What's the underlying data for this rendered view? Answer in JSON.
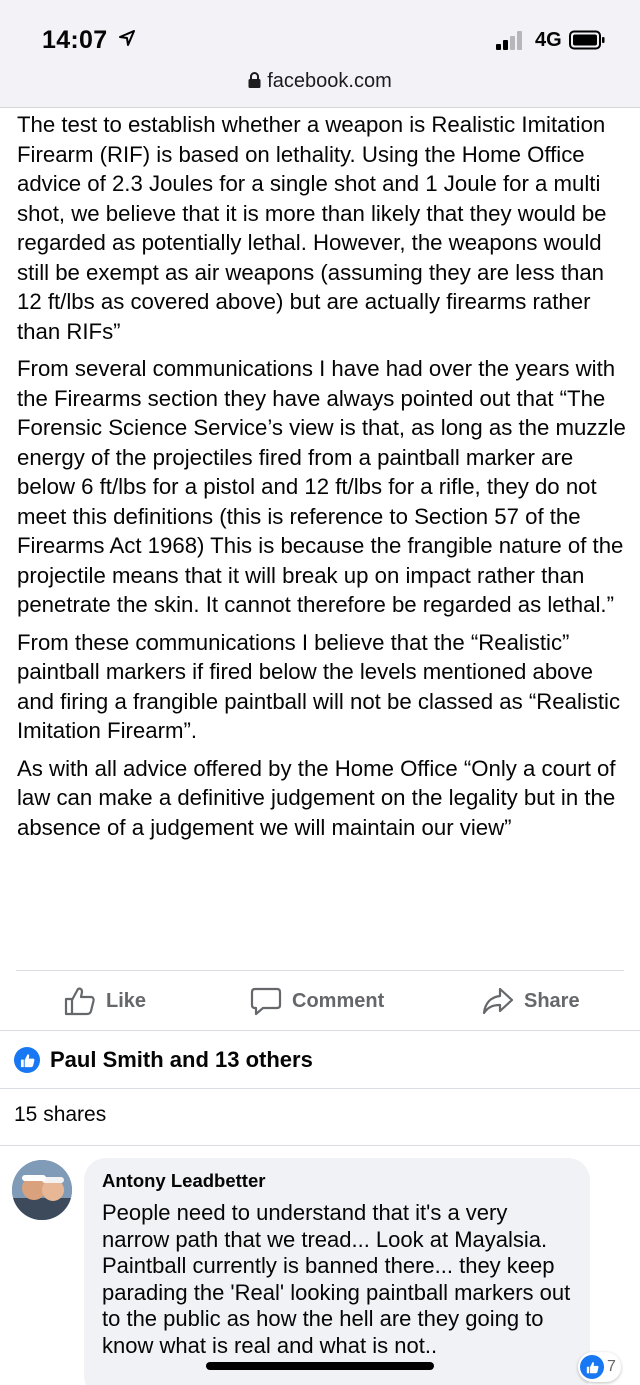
{
  "status_bar": {
    "time": "14:07",
    "network": "4G",
    "url": "facebook.com"
  },
  "post": {
    "paragraphs": [
      "The test to establish whether a weapon is Realistic Imitation Firearm (RIF) is based on lethality. Using the Home Office advice of 2.3 Joules for a single shot and 1 Joule for a multi shot, we believe that it is more than likely that they would be regarded as potentially lethal. However, the weapons would still be exempt as air weapons (assuming they are less than 12 ft/lbs as covered above) but are actually firearms rather than RIFs”",
      "From several communications I have had over the years with the Firearms section they have always pointed out that “The Forensic Science Service’s view is that, as long as the muzzle energy of the projectiles fired from a paintball marker are below 6 ft/lbs for a pistol and 12 ft/lbs for a rifle, they do not meet this definitions (this is reference to Section 57 of the Firearms Act 1968) This is because the frangible nature of the projectile means that it will break up on impact rather than penetrate the skin. It cannot therefore be regarded as lethal.”",
      "From these communications I believe that the “Realistic” paintball markers if fired below the levels mentioned above and firing a frangible paintball will not be classed as “Realistic Imitation Firearm”.",
      "As with all advice offered by the Home Office “Only a court of law can make a definitive judgement on the legality but in the absence of a judgement we will maintain our view”"
    ]
  },
  "actions": {
    "like": "Like",
    "comment": "Comment",
    "share": "Share"
  },
  "reactions": {
    "summary": "Paul Smith and 13 others"
  },
  "shares": "15 shares",
  "comment": {
    "author": "Antony Leadbetter",
    "text": "People need to understand that it's a very narrow path that we tread... Look at Mayalsia. Paintball currently is banned there... they keep parading the 'Real' looking paintball markers out to the public as how the hell are they going to know what is real and what is not..",
    "like_count": "7"
  },
  "colors": {
    "accent": "#1877f2",
    "secondary_text": "#65676b",
    "bubble": "#f0f2f5"
  }
}
